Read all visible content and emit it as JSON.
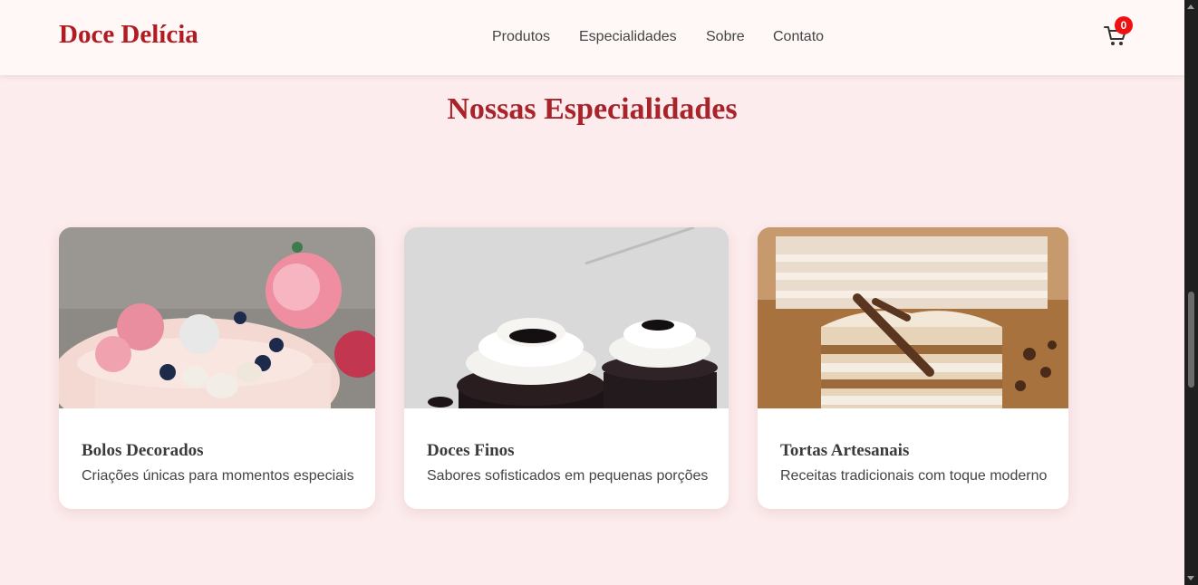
{
  "header": {
    "logo": "Doce Delícia",
    "nav": [
      "Produtos",
      "Especialidades",
      "Sobre",
      "Contato"
    ],
    "cart_count": "0"
  },
  "section": {
    "title": "Nossas Especialidades"
  },
  "cards": [
    {
      "title": "Bolos Decorados",
      "description": "Criações únicas para momentos especiais"
    },
    {
      "title": "Doces Finos",
      "description": "Sabores sofisticados em pequenas porções"
    },
    {
      "title": "Tortas Artesanais",
      "description": "Receitas tradicionais com toque moderno"
    }
  ],
  "colors": {
    "brand": "#b01c22",
    "page_background": "#fdeced",
    "badge": "#ee1111"
  }
}
